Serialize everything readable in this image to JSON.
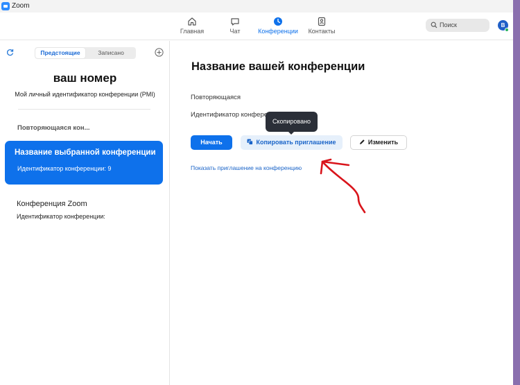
{
  "window": {
    "title": "Zoom"
  },
  "nav": {
    "home": "Главная",
    "chat": "Чат",
    "meetings": "Конференции",
    "contacts": "Контакты"
  },
  "search": {
    "placeholder": "Поиск"
  },
  "avatar": {
    "initial": "В"
  },
  "left": {
    "tabs": {
      "upcoming": "Предстоящие",
      "recorded": "Записано"
    },
    "pmi": {
      "number": "ваш номер",
      "label": "Мой личный идентификатор конференции (PMI)"
    },
    "recurring_header": "Повторяющаяся кон...",
    "selected": {
      "title": "Название выбранной конференции",
      "id": "Идентификатор конференции: 9"
    },
    "item": {
      "title": "Конференция Zoom",
      "id": "Идентификатор конференции:"
    }
  },
  "right": {
    "title": "Название вашей конференции",
    "recurring": "Повторяющаяся",
    "meeting_id_label": "Идентификатор конфере",
    "tooltip": "Скопировано",
    "buttons": {
      "start": "Начать",
      "copy": "Копировать приглашение",
      "edit": "Изменить"
    },
    "show_invite": "Показать приглашение на конференцию"
  },
  "colors": {
    "accent": "#0e71eb",
    "annotation": "#d9141b",
    "desktop": "#8a6fae"
  }
}
